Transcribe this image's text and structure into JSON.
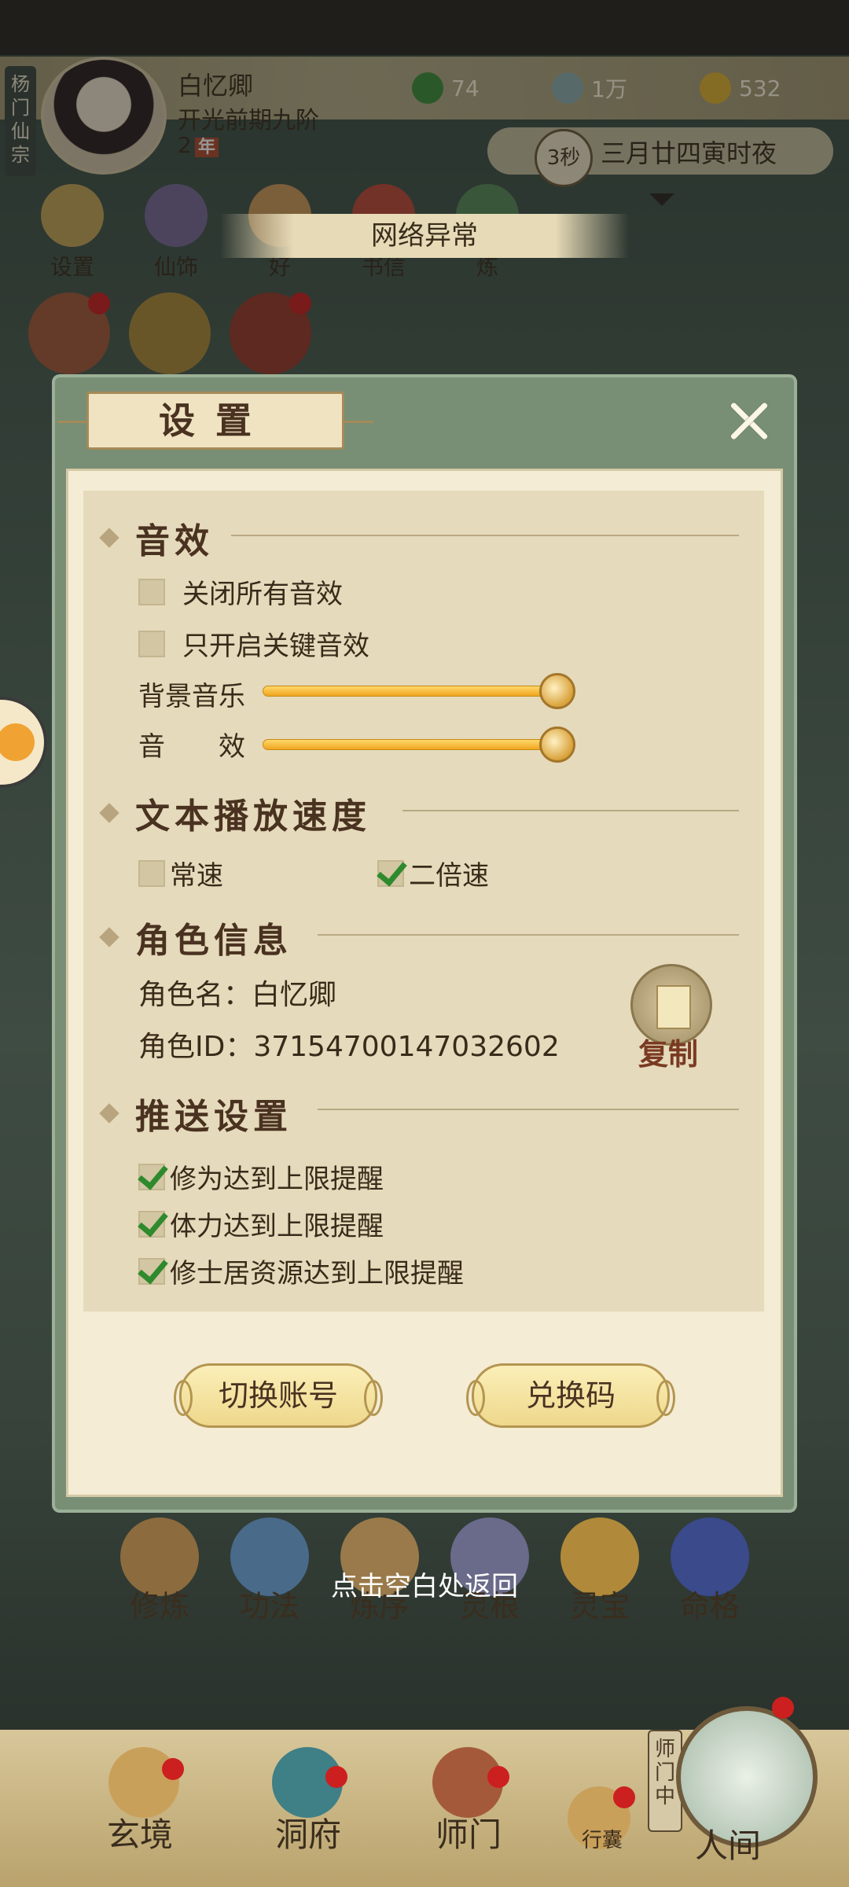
{
  "profile": {
    "sect": "杨门仙宗",
    "name": "白忆卿",
    "rank": "开光前期九阶",
    "age_number": "2",
    "age_unit": "年"
  },
  "resources": [
    {
      "icon": "leaf-icon",
      "value": "74"
    },
    {
      "icon": "coin-icon",
      "value": "1万"
    },
    {
      "icon": "ingot-icon",
      "value": "532"
    }
  ],
  "time": {
    "seconds": "3秒",
    "date_text": "三月廿四寅时夜"
  },
  "top_icons": [
    "设置",
    "仙饰",
    "好",
    "书信",
    "炼"
  ],
  "network_banner": "网络异常",
  "settings": {
    "title": "设置",
    "sound": {
      "header": "音效",
      "mute_all": {
        "label": "关闭所有音效",
        "checked": false
      },
      "key_only": {
        "label": "只开启关键音效",
        "checked": false
      },
      "bgm": {
        "label": "背景音乐",
        "level": 1.0
      },
      "sfx": {
        "label": "音　　效",
        "level": 1.0
      }
    },
    "text_speed": {
      "header": "文本播放速度",
      "normal": {
        "label": "常速",
        "checked": false
      },
      "double": {
        "label": "二倍速",
        "checked": true
      }
    },
    "role": {
      "header": "角色信息",
      "name_label": "角色名：",
      "name_value": "白忆卿",
      "id_label": "角色ID：",
      "id_value": "37154700147032602",
      "copy_label": "复制"
    },
    "push": {
      "header": "推送设置",
      "items": [
        {
          "label": "修为达到上限提醒",
          "checked": true
        },
        {
          "label": "体力达到上限提醒",
          "checked": true
        },
        {
          "label": "修士居资源达到上限提醒",
          "checked": true
        }
      ]
    },
    "switch_account": "切换账号",
    "redeem_code": "兑换码"
  },
  "dismiss_hint": "点击空白处返回",
  "skills": [
    "修炼",
    "功法",
    "炼序",
    "灵根",
    "灵宝",
    "命格"
  ],
  "nav": {
    "tab1": "玄境",
    "tab2": "洞府",
    "tab3": "师门",
    "bag": "行囊",
    "shimen_tag": "师门中",
    "tab5": "人间"
  },
  "colors": {
    "accent_green": "#2f8a2d",
    "panel_bg": "#f4ecd4",
    "frame": "#788f76",
    "alert_red": "#cc1f1f"
  }
}
